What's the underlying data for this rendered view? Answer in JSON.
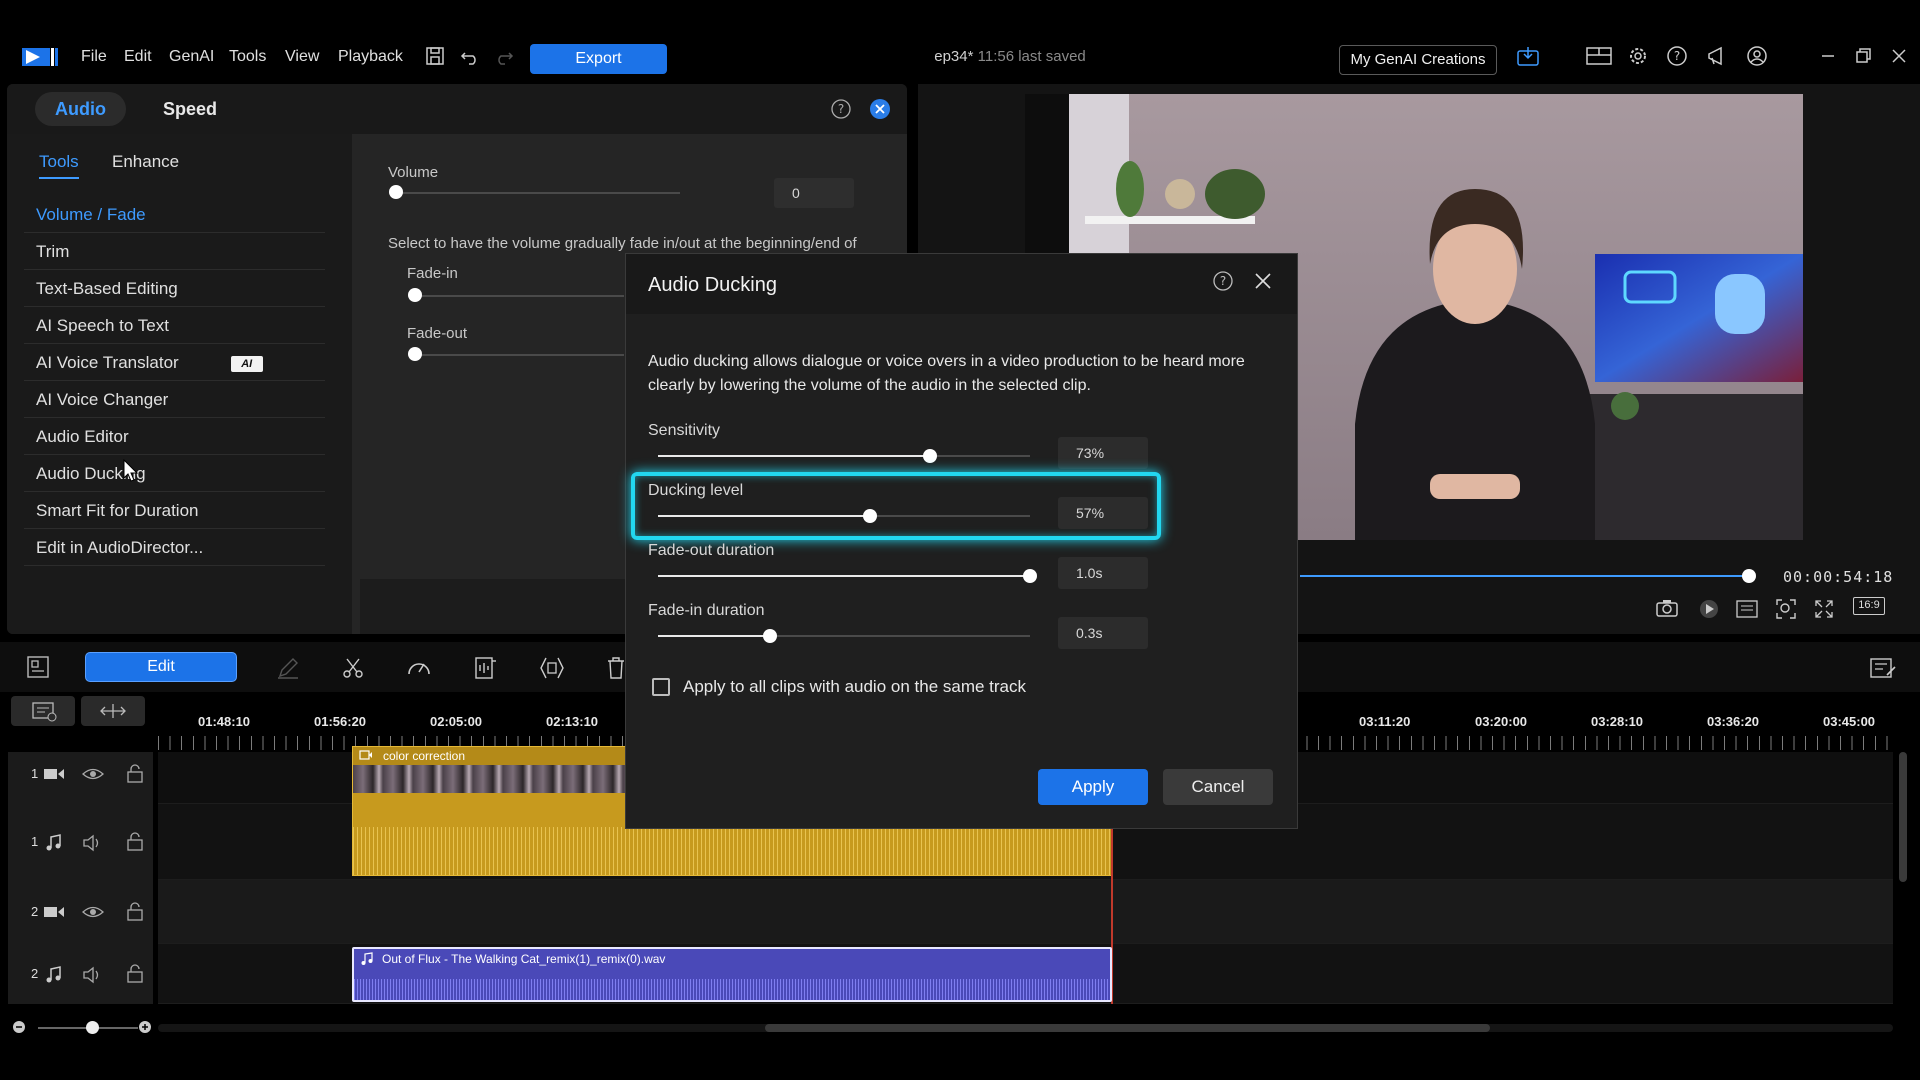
{
  "menu": {
    "items": [
      "File",
      "Edit",
      "GenAI",
      "Tools",
      "View",
      "Playback"
    ],
    "export_label": "Export"
  },
  "project": {
    "name": "ep34*",
    "saved": "11:56 last saved"
  },
  "topbar": {
    "genai_label": "My GenAI Creations"
  },
  "panel": {
    "tabs": [
      "Audio",
      "Speed"
    ],
    "subtabs": [
      "Tools",
      "Enhance"
    ],
    "tools": [
      "Volume / Fade",
      "Trim",
      "Text-Based Editing",
      "AI Speech to Text",
      "AI Voice Translator",
      "AI Voice Changer",
      "Audio Editor",
      "Audio Ducking",
      "Smart Fit for Duration",
      "Edit in AudioDirector..."
    ],
    "ai_badge": "AI",
    "volume_label": "Volume",
    "volume_value": "0",
    "fade_desc": "Select to have the volume gradually fade in/out at the beginning/end of",
    "fade_in_label": "Fade-in",
    "fade_out_label": "Fade-out"
  },
  "preview": {
    "timecode": "00:00:54:18",
    "aspect": "16:9"
  },
  "timeline": {
    "edit_label": "Edit",
    "ruler": [
      "01:48:10",
      "01:56:20",
      "02:05:00",
      "02:13:10",
      "03:11:20",
      "03:20:00",
      "03:28:10",
      "03:36:20",
      "03:45:00"
    ],
    "tracks": [
      {
        "num": "1",
        "kind": "video"
      },
      {
        "num": "1",
        "kind": "audio"
      },
      {
        "num": "2",
        "kind": "video"
      },
      {
        "num": "2",
        "kind": "audio"
      }
    ],
    "clip_video_label": "color correction",
    "clip_music_label": "Out of Flux - The Walking Cat_remix(1)_remix(0).wav"
  },
  "dialog": {
    "title": "Audio Ducking",
    "description": "Audio ducking allows dialogue or voice overs in a video production to be heard more clearly by lowering the volume of the audio in the selected clip.",
    "sensitivity_label": "Sensitivity",
    "sensitivity_value": "73%",
    "sensitivity_level": 0.73,
    "ducking_label": "Ducking level",
    "ducking_value": "57%",
    "ducking_level": 0.57,
    "fadeout_label": "Fade-out duration",
    "fadeout_value": "1.0s",
    "fadeout_level": 1.0,
    "fadein_label": "Fade-in duration",
    "fadein_value": "0.3s",
    "fadein_level": 0.3,
    "apply_all_label": "Apply to all clips with audio on the same track",
    "apply_label": "Apply",
    "cancel_label": "Cancel"
  },
  "colors": {
    "accent": "#1c73e8",
    "highlight": "#22d7f0",
    "audio_clip": "#c79a1e",
    "music_clip": "#4a49b8"
  }
}
